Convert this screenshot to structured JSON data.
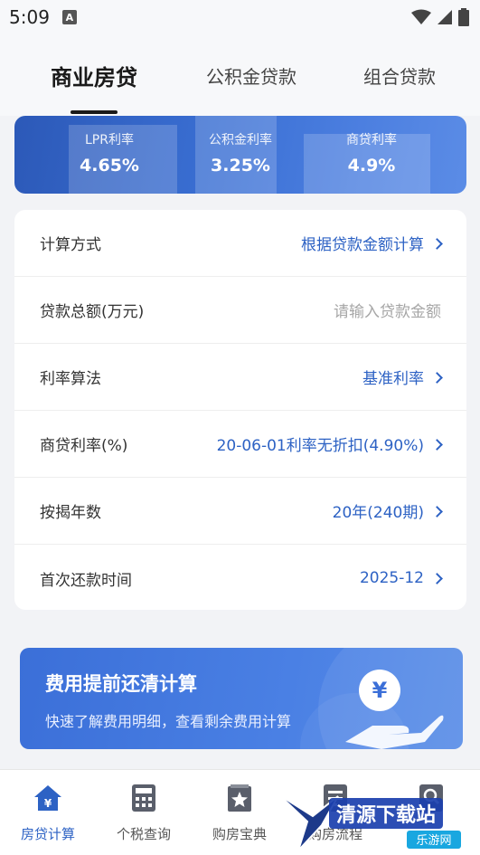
{
  "status_bar": {
    "time": "5:09"
  },
  "tabs": [
    {
      "label": "商业房贷",
      "active": true
    },
    {
      "label": "公积金贷款",
      "active": false
    },
    {
      "label": "组合贷款",
      "active": false
    }
  ],
  "rates": [
    {
      "label": "LPR利率",
      "value": "4.65%"
    },
    {
      "label": "公积金利率",
      "value": "3.25%"
    },
    {
      "label": "商贷利率",
      "value": "4.9%"
    }
  ],
  "form": {
    "calc_method": {
      "label": "计算方式",
      "value": "根据贷款金额计算"
    },
    "loan_total": {
      "label": "贷款总额(万元)",
      "placeholder": "请输入贷款金额"
    },
    "rate_method": {
      "label": "利率算法",
      "value": "基准利率"
    },
    "commercial_rate": {
      "label": "商贷利率(%)",
      "value": "20-06-01利率无折扣(4.90%)"
    },
    "mortgage_years": {
      "label": "按揭年数",
      "value": "20年(240期)"
    },
    "first_payment": {
      "label": "首次还款时间",
      "value": "2025-12"
    }
  },
  "promo": {
    "title": "费用提前还清计算",
    "subtitle": "快速了解费用明细，查看剩余费用计算",
    "coin_symbol": "¥"
  },
  "bottom_nav": [
    {
      "label": "房贷计算",
      "icon": "house-yen-icon",
      "active": true
    },
    {
      "label": "个税查询",
      "icon": "calculator-icon",
      "active": false
    },
    {
      "label": "购房宝典",
      "icon": "book-star-icon",
      "active": false
    },
    {
      "label": "购房流程",
      "icon": "list-icon",
      "active": false
    },
    {
      "label": "",
      "icon": "search-doc-icon",
      "active": false
    }
  ],
  "watermark": {
    "text": "清源下载站",
    "sub": "乐游网"
  },
  "colors": {
    "accent": "#2d62c4",
    "banner": "#3a6fd3",
    "background": "#f2f3f6"
  }
}
